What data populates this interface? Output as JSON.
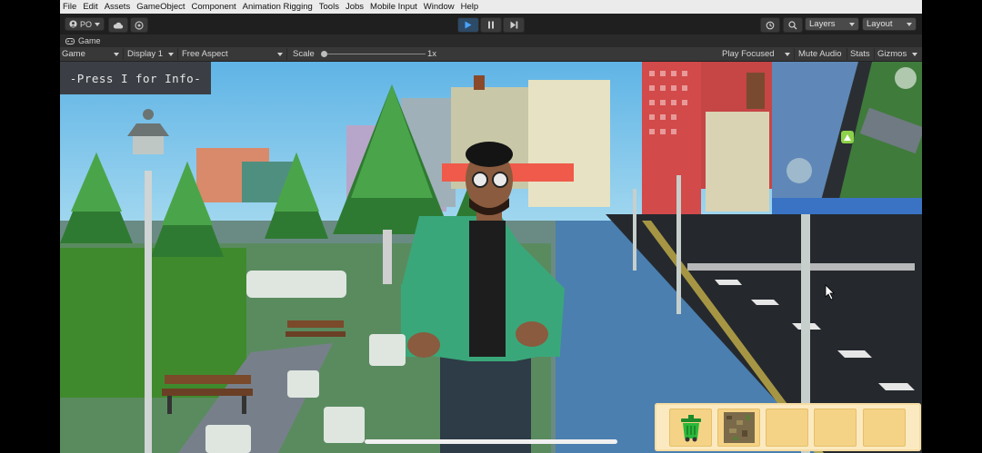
{
  "menu": [
    "File",
    "Edit",
    "Assets",
    "GameObject",
    "Component",
    "Animation Rigging",
    "Tools",
    "Jobs",
    "Mobile Input",
    "Window",
    "Help"
  ],
  "toolbar": {
    "account_label": "PO",
    "layers_label": "Layers",
    "layout_label": "Layout"
  },
  "tab": {
    "title": "Game"
  },
  "gamebar": {
    "mode": "Game",
    "display": "Display 1",
    "aspect": "Free Aspect",
    "scale_label": "Scale",
    "scale_value": "1x",
    "play_focused": "Play Focused",
    "mute_audio": "Mute Audio",
    "stats": "Stats",
    "gizmos": "Gizmos"
  },
  "hud": {
    "info_text": "-Press I for Info-",
    "inventory_slots": [
      "trash-can-icon",
      "dirt-block-icon",
      "empty",
      "empty",
      "empty"
    ]
  },
  "colors": {
    "sky": "#7fc4e8",
    "grass": "#3f8a2d",
    "road": "#25292e",
    "sidewalk": "#4a7fb0",
    "jacket": "#3aa77a",
    "inventory_bg": "#fbeac1",
    "slot": "#f4d387",
    "play_accent": "#4aa3ff"
  }
}
